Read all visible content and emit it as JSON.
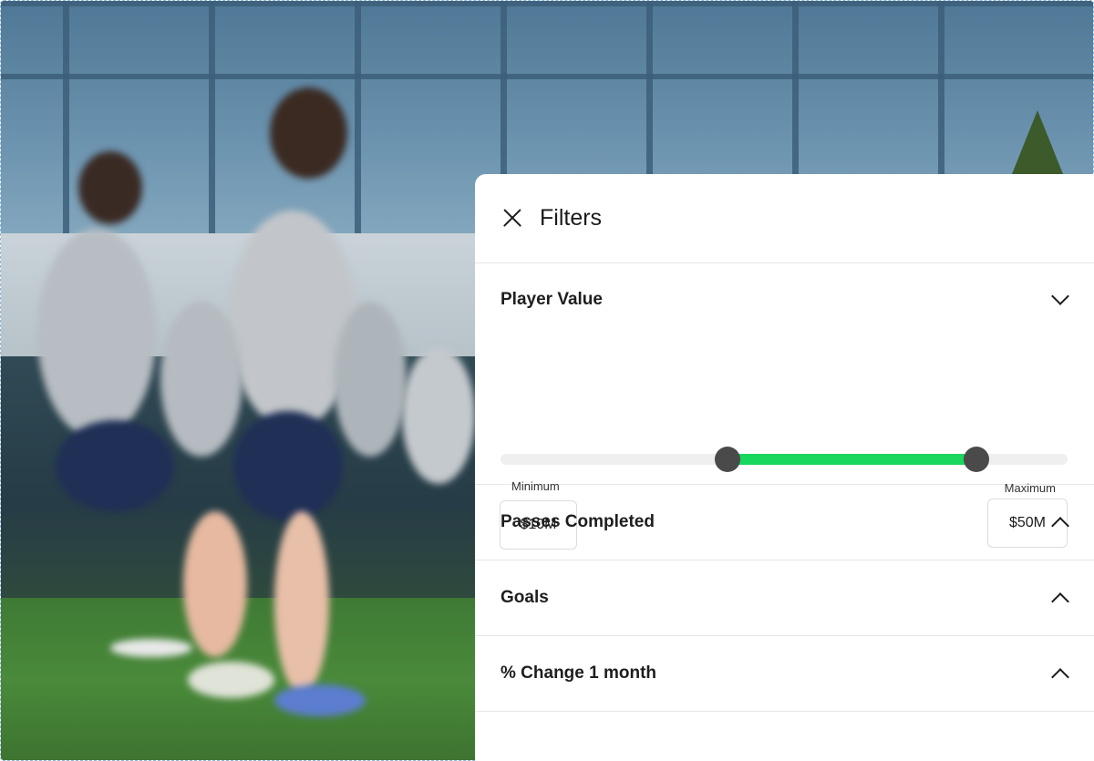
{
  "panel": {
    "title": "Filters",
    "close_icon": "close-icon"
  },
  "player_value": {
    "label": "Player Value",
    "expanded": true,
    "range_min_fraction": 0.4,
    "range_max_fraction": 0.84,
    "minimum_label": "Minimum",
    "maximum_label": "Maximum",
    "minimum_value": "$10M",
    "maximum_value": "$50M",
    "accent_color": "#19d65d"
  },
  "sections": [
    {
      "label": "Passes Completed",
      "expanded": false
    },
    {
      "label": "Goals",
      "expanded": false
    },
    {
      "label": "% Change 1 month",
      "expanded": false
    }
  ]
}
